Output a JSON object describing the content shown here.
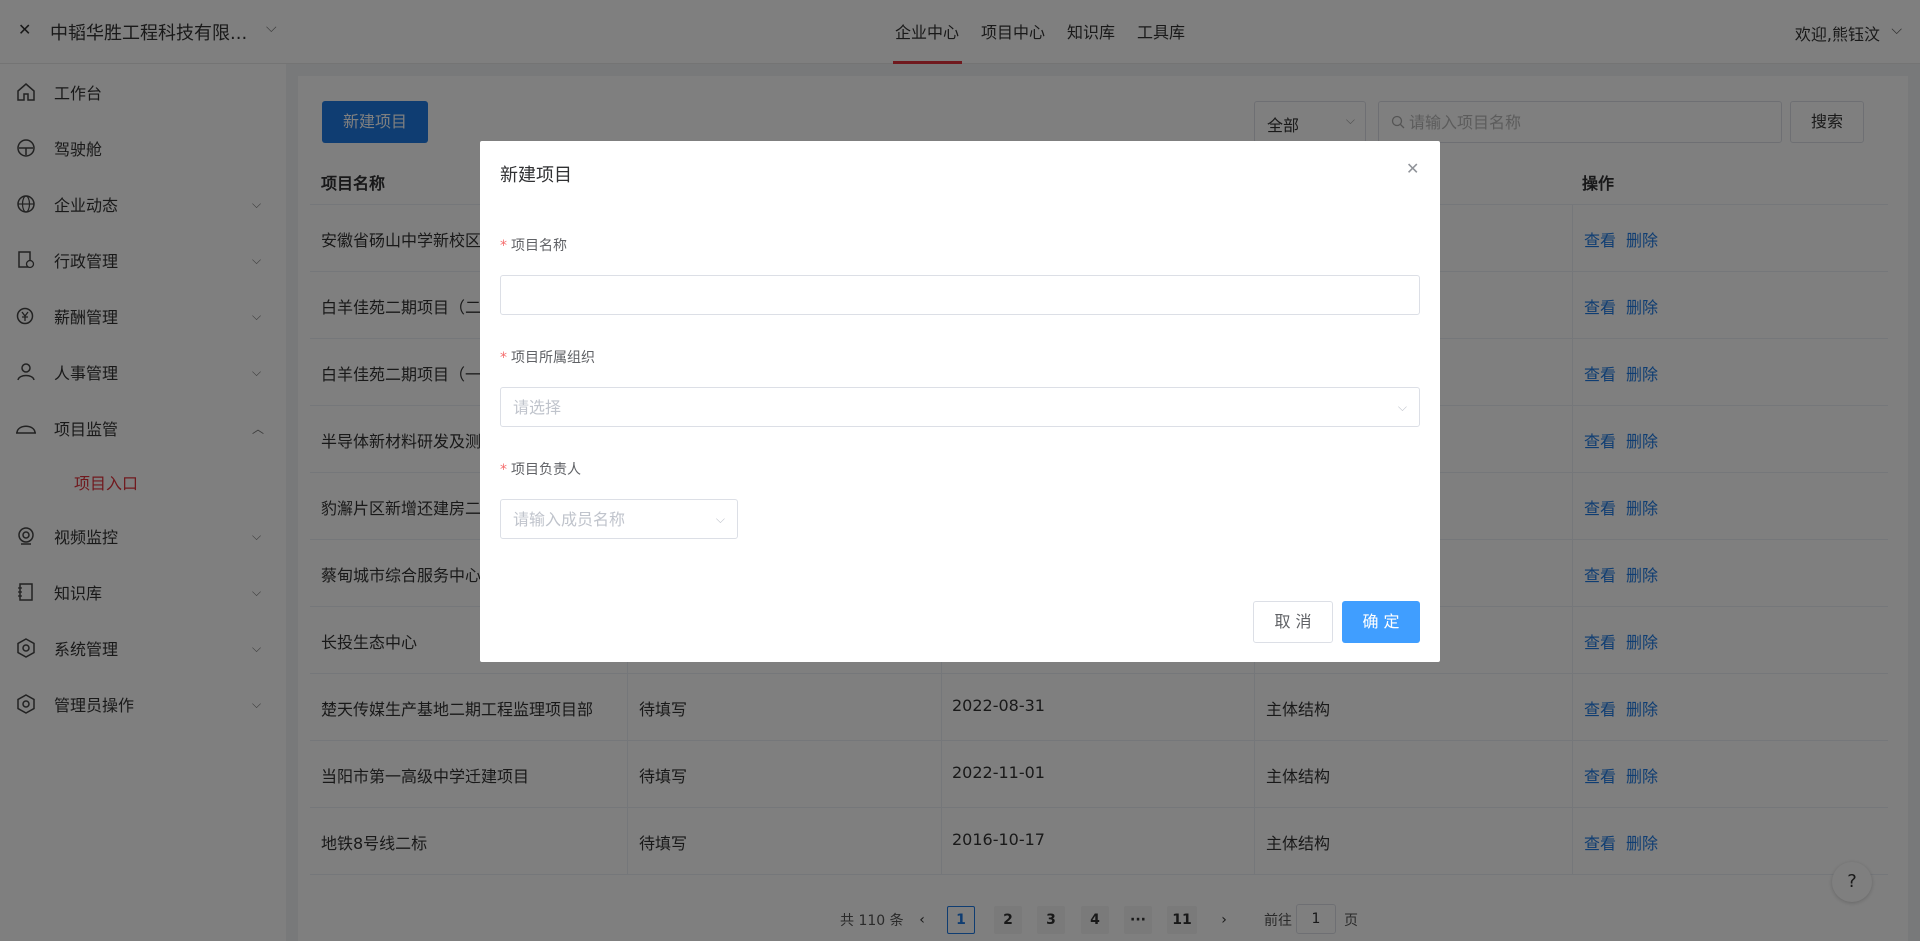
{
  "header": {
    "company": "中韬华胜工程科技有限...",
    "nav": [
      "企业中心",
      "项目中心",
      "知识库",
      "工具库"
    ],
    "active_nav": "企业中心",
    "welcome": "欢迎,熊钰汶"
  },
  "sidebar": {
    "items": [
      {
        "label": "工作台",
        "icon": "home-icon"
      },
      {
        "label": "驾驶舱",
        "icon": "dashboard-icon"
      },
      {
        "label": "企业动态",
        "icon": "globe-icon"
      },
      {
        "label": "行政管理",
        "icon": "document-settings-icon"
      },
      {
        "label": "薪酬管理",
        "icon": "salary-icon"
      },
      {
        "label": "人事管理",
        "icon": "user-icon"
      },
      {
        "label": "项目监管",
        "icon": "helmet-icon"
      },
      {
        "label": "视频监控",
        "icon": "camera-icon"
      },
      {
        "label": "知识库",
        "icon": "book-icon"
      },
      {
        "label": "系统管理",
        "icon": "settings-icon"
      },
      {
        "label": "管理员操作",
        "icon": "admin-settings-icon"
      }
    ],
    "sub_item": "项目入口"
  },
  "toolbar": {
    "new_project": "新建项目",
    "filter_value": "全部",
    "search_placeholder": "请输入项目名称",
    "search_button": "搜索"
  },
  "table": {
    "headers": {
      "name": "项目名称",
      "actions": "操作"
    },
    "rows": [
      {
        "name": "安徽省砀山中学新校区",
        "status": "",
        "date": "",
        "stage": ""
      },
      {
        "name": "白羊佳苑二期项目（二",
        "status": "",
        "date": "",
        "stage": ""
      },
      {
        "name": "白羊佳苑二期项目（一",
        "status": "",
        "date": "",
        "stage": ""
      },
      {
        "name": "半导体新材料研发及测",
        "status": "",
        "date": "",
        "stage": ""
      },
      {
        "name": "豹澥片区新增还建房二",
        "status": "",
        "date": "",
        "stage": ""
      },
      {
        "name": "蔡甸城市综合服务中心",
        "status": "",
        "date": "",
        "stage": ""
      },
      {
        "name": "长投生态中心",
        "status": "",
        "date": "",
        "stage": ""
      },
      {
        "name": "楚天传媒生产基地二期工程监理项目部",
        "status": "待填写",
        "date": "2022-08-31",
        "stage": "主体结构"
      },
      {
        "name": "当阳市第一高级中学迁建项目",
        "status": "待填写",
        "date": "2022-11-01",
        "stage": "主体结构"
      },
      {
        "name": "地铁8号线二标",
        "status": "待填写",
        "date": "2016-10-17",
        "stage": "主体结构"
      }
    ],
    "view_label": "查看",
    "delete_label": "删除"
  },
  "pagination": {
    "total": "共 110 条",
    "pages": [
      "1",
      "2",
      "3",
      "4",
      "···",
      "11"
    ],
    "current": "1",
    "goto_prefix": "前往",
    "goto_value": "1",
    "goto_suffix": "页"
  },
  "help": "?",
  "modal": {
    "title": "新建项目",
    "fields": {
      "name_label": "项目名称",
      "org_label": "项目所属组织",
      "org_placeholder": "请选择",
      "leader_label": "项目负责人",
      "leader_placeholder": "请输入成员名称"
    },
    "cancel": "取 消",
    "confirm": "确 定"
  },
  "colors": {
    "accent": "#1e7ae4",
    "active_red": "#e0333c",
    "primary_button": "#409eff"
  }
}
